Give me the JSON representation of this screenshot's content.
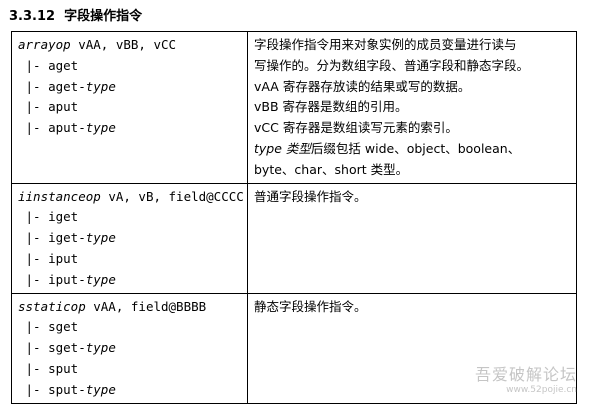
{
  "heading": {
    "number": "3.3.12",
    "title": "字段操作指令"
  },
  "rows": [
    {
      "op_name": "arrayop",
      "op_args": " vAA, vBB, vCC",
      "variants": [
        {
          "base": "aget",
          "suffix": ""
        },
        {
          "base": "aget-",
          "suffix": "type"
        },
        {
          "base": "aput",
          "suffix": ""
        },
        {
          "base": "aput-",
          "suffix": "type"
        }
      ],
      "desc": [
        "字段操作指令用来对象实例的成员变量进行读与",
        "写操作的。分为数组字段、普通字段和静态字段。",
        "vAA 寄存器存放读的结果或写的数据。",
        "vBB 寄存器是数组的引用。",
        "vCC 寄存器是数组读写元素的索引。"
      ],
      "desc_type_italic": "type 类型",
      "desc_type_rest": "后缀包括 wide、object、boolean、",
      "desc_type_line2": "byte、char、short 类型。"
    },
    {
      "op_name": "iinstanceop",
      "op_args": " vA, vB, field@CCCC",
      "variants": [
        {
          "base": "iget",
          "suffix": ""
        },
        {
          "base": "iget-",
          "suffix": "type"
        },
        {
          "base": "iput",
          "suffix": ""
        },
        {
          "base": "iput-",
          "suffix": "type"
        }
      ],
      "desc": [
        "普通字段操作指令。"
      ]
    },
    {
      "op_name": "sstaticop",
      "op_args": " vAA, field@BBBB",
      "variants": [
        {
          "base": "sget",
          "suffix": ""
        },
        {
          "base": "sget-",
          "suffix": "type"
        },
        {
          "base": "sput",
          "suffix": ""
        },
        {
          "base": "sput-",
          "suffix": "type"
        }
      ],
      "desc": [
        "静态字段操作指令。"
      ]
    }
  ],
  "variant_prefix": " |- ",
  "watermark": {
    "text": "吾爱破解论坛",
    "url": "www.52pojie.cn"
  }
}
